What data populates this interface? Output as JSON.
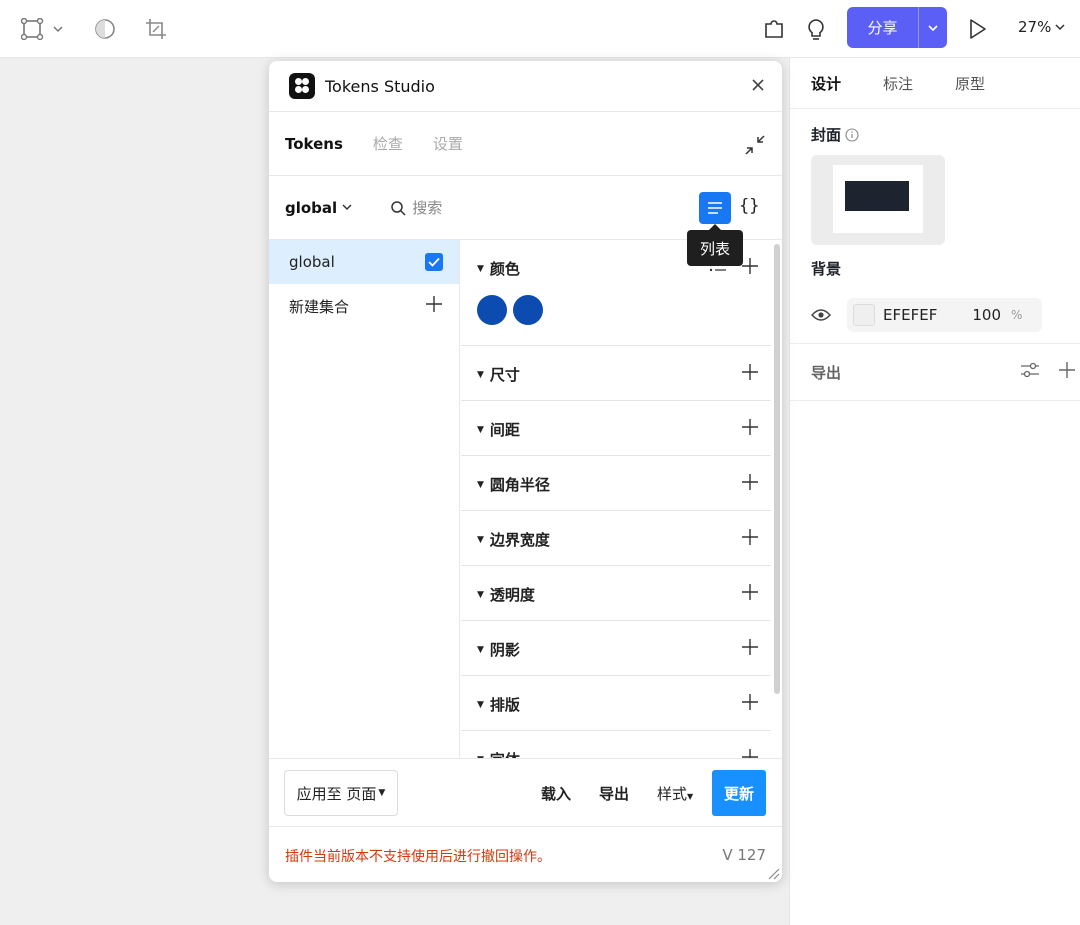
{
  "topbar": {
    "share_label": "分享",
    "zoom": "27%"
  },
  "right_panel": {
    "tabs": [
      {
        "label": "设计",
        "active": true
      },
      {
        "label": "标注",
        "active": false
      },
      {
        "label": "原型",
        "active": false
      }
    ],
    "cover_label": "封面",
    "background_label": "背景",
    "background_hex": "EFEFEF",
    "background_opacity": "100",
    "percent": "%",
    "export_label": "导出"
  },
  "plugin": {
    "title": "Tokens Studio",
    "tabs": [
      {
        "label": "Tokens",
        "active": true
      },
      {
        "label": "检查",
        "active": false
      },
      {
        "label": "设置",
        "active": false
      }
    ],
    "set_select": "global",
    "search_placeholder": "搜索",
    "tooltip": "列表",
    "json_glyph": "{}",
    "sets": [
      {
        "label": "global",
        "checked": true
      },
      {
        "label": "新建集合"
      }
    ],
    "groups": [
      {
        "label": "颜色"
      },
      {
        "label": "尺寸"
      },
      {
        "label": "间距"
      },
      {
        "label": "圆角半径"
      },
      {
        "label": "边界宽度"
      },
      {
        "label": "透明度"
      },
      {
        "label": "阴影"
      },
      {
        "label": "排版"
      },
      {
        "label": "字体"
      }
    ],
    "color_swatch": "#0c4bb0",
    "footer": {
      "apply_label": "应用至 页面",
      "load_label": "载入",
      "export_label": "导出",
      "styles_label": "样式",
      "update_label": "更新"
    },
    "warning": "插件当前版本不支持使用后进行撤回操作。",
    "version": "V 127"
  }
}
